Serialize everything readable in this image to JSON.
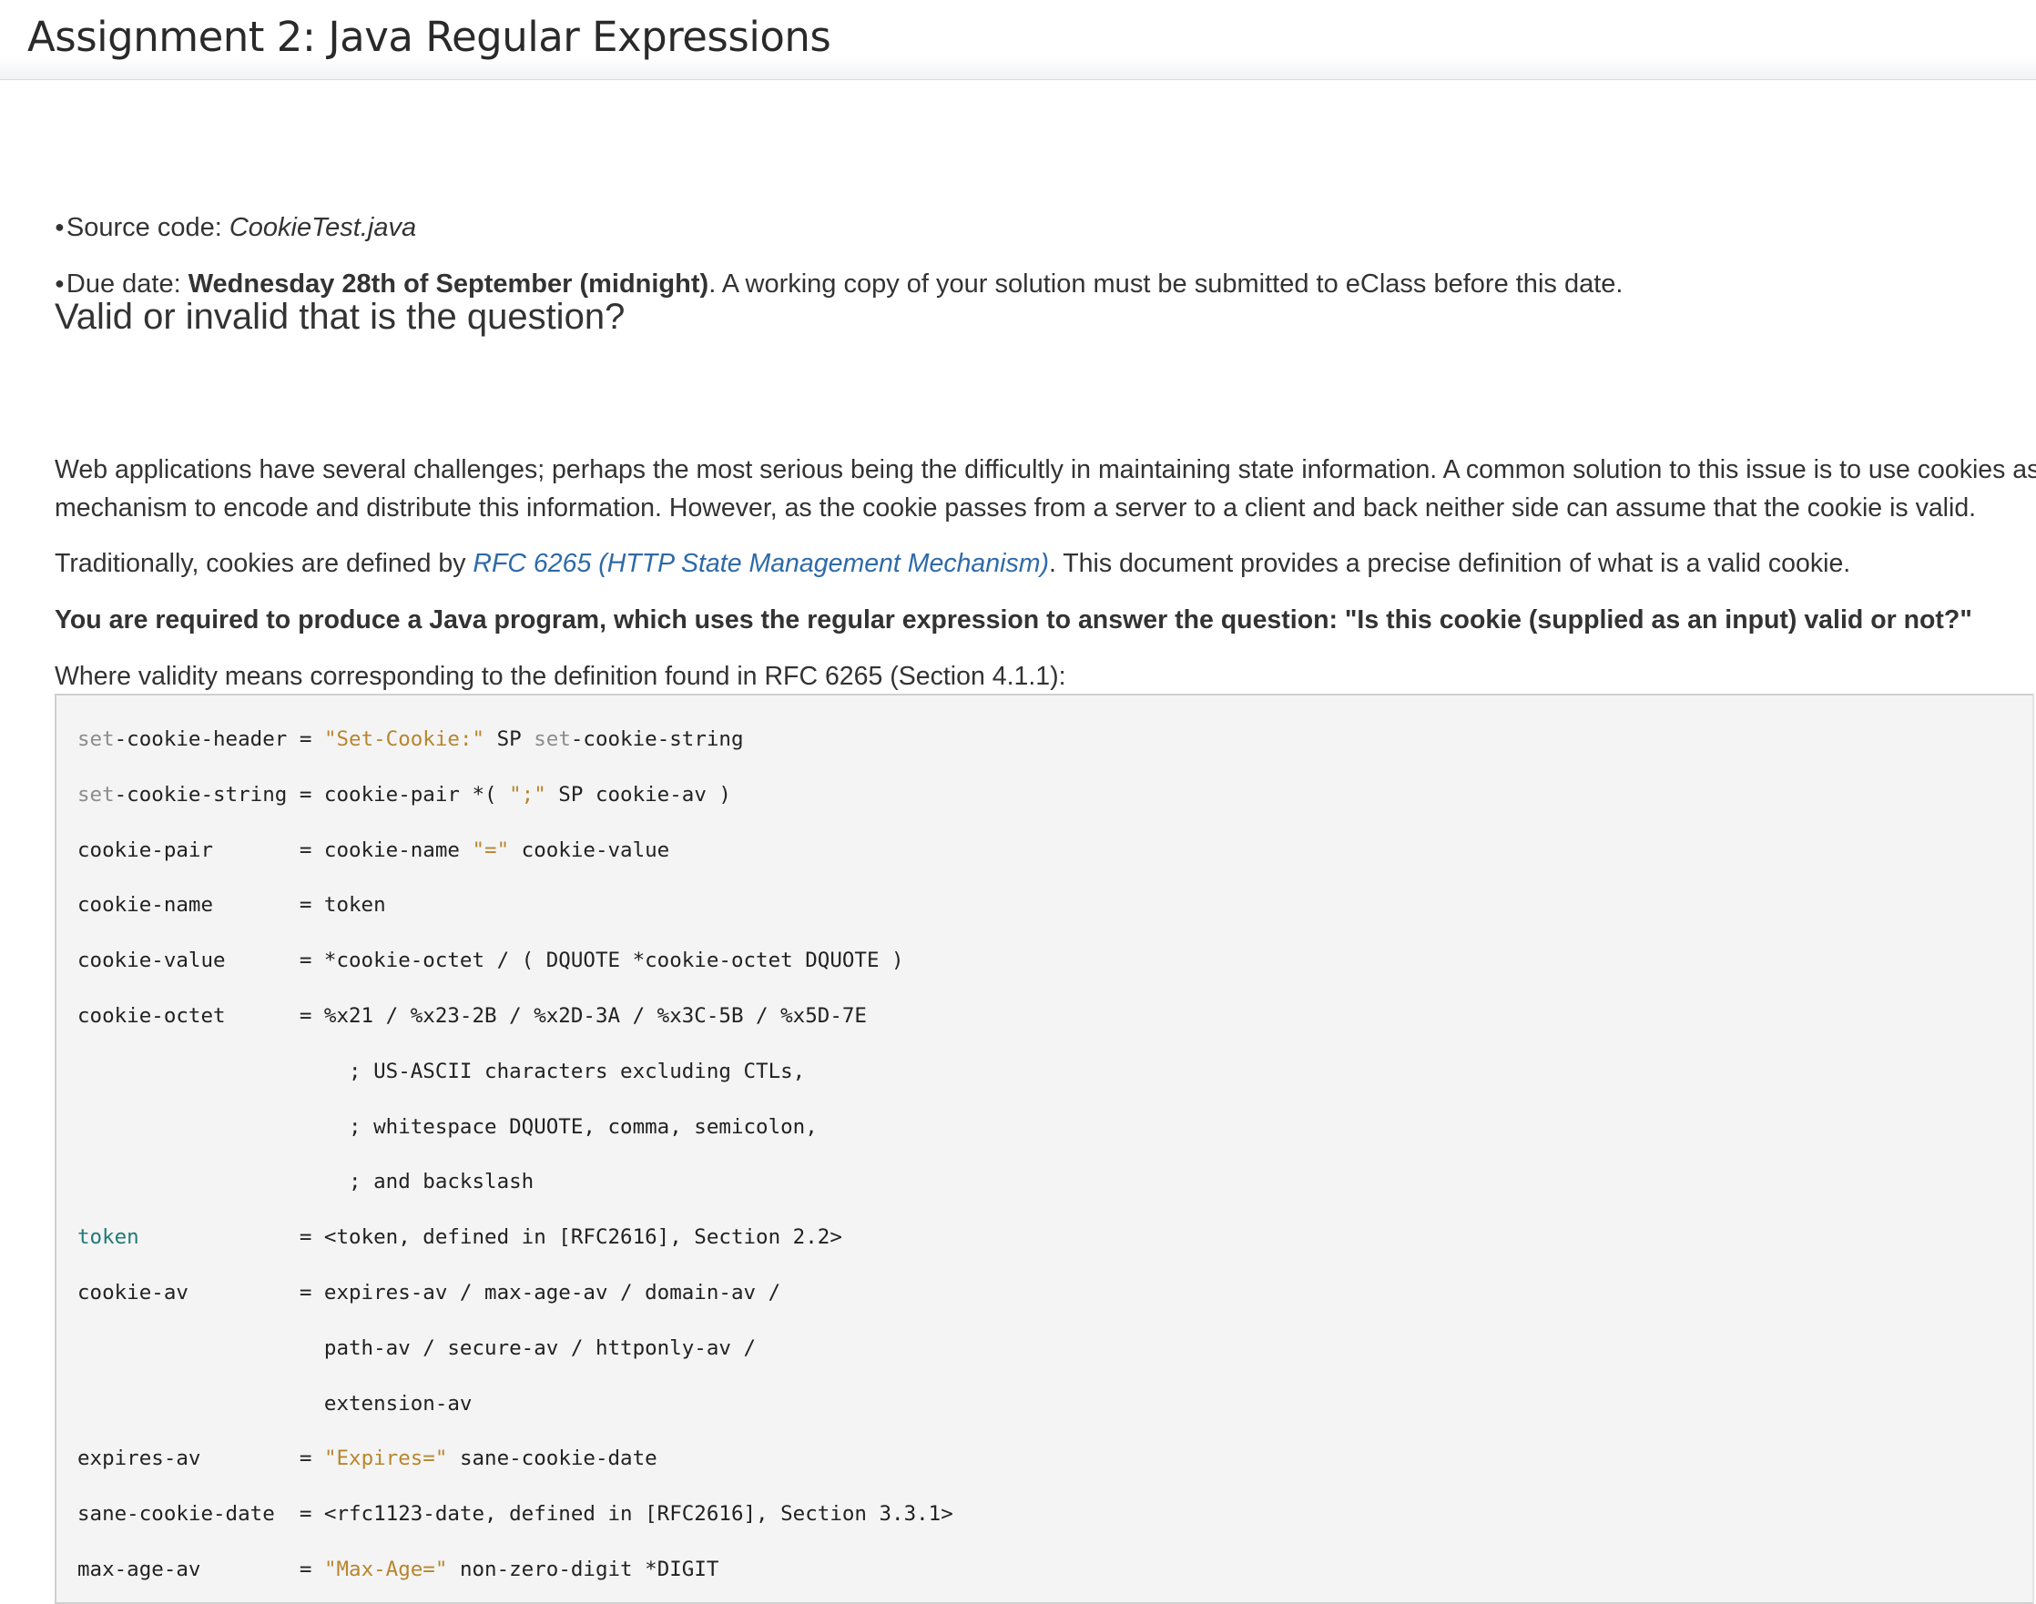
{
  "page": {
    "title": "Assignment 2: Java Regular Expressions"
  },
  "info": {
    "source_label": "Source code: ",
    "source_file": "CookieTest.java",
    "due_label": "Due date: ",
    "due_date": "Wednesday 28th of September (midnight)",
    "due_note": ". A working copy of your solution must be submitted to eClass before this date."
  },
  "section": {
    "heading": "Valid or invalid that is the question?",
    "para1_line1": "Web applications have several challenges; perhaps the most serious being the difficultly in maintaining state information. A common solution to this issue is to use cookies as a",
    "para1_line2": "mechanism to encode and distribute this information. However, as the cookie passes from a server to a client and back neither side can assume that the cookie is valid.",
    "para2_pre": "Traditionally, cookies are defined by ",
    "para2_link": "RFC 6265 (HTTP State Management Mechanism)",
    "para2_post": ". This document provides a precise definition of what is a valid cookie.",
    "requirement": "You are required to produce a Java program, which uses the regular expression to answer the question: \"Is this cookie (supplied as an input) valid or not?\"",
    "validity": "Where validity means corresponding to the definition found in RFC 6265 (Section 4.1.1):"
  },
  "code": {
    "l1": [
      {
        "t": "set",
        "c": "kw"
      },
      {
        "t": "-cookie-header = "
      },
      {
        "t": "\"Set-Cookie:\"",
        "c": "str"
      },
      {
        "t": " SP "
      },
      {
        "t": "set",
        "c": "kw"
      },
      {
        "t": "-cookie-string"
      }
    ],
    "l2": [
      {
        "t": "set",
        "c": "kw"
      },
      {
        "t": "-cookie-string = cookie-pair *( "
      },
      {
        "t": "\";\"",
        "c": "str"
      },
      {
        "t": " SP cookie-av )"
      }
    ],
    "l3": [
      {
        "t": "cookie-pair       = cookie-name "
      },
      {
        "t": "\"=\"",
        "c": "str"
      },
      {
        "t": " cookie-value"
      }
    ],
    "l4": [
      {
        "t": "cookie-name       = token"
      }
    ],
    "l5": [
      {
        "t": "cookie-value      = *cookie-octet / ( DQUOTE *cookie-octet DQUOTE )"
      }
    ],
    "l6": [
      {
        "t": "cookie-octet      = %x21 / %x23-2B / %x2D-3A / %x3C-5B / %x5D-7E"
      }
    ],
    "l7": [
      {
        "t": "                      ; US-ASCII characters excluding CTLs,"
      }
    ],
    "l8": [
      {
        "t": "                      ; whitespace DQUOTE, comma, semicolon,"
      }
    ],
    "l9": [
      {
        "t": "                      ; and backslash"
      }
    ],
    "l10": [
      {
        "t": "token",
        "c": "tok"
      },
      {
        "t": "             = <token, defined in [RFC2616], Section 2.2>"
      }
    ],
    "l11": [
      {
        "t": "cookie-av         = expires-av / max-age-av / domain-av /"
      }
    ],
    "l12": [
      {
        "t": "                    path-av / secure-av / httponly-av /"
      }
    ],
    "l13": [
      {
        "t": "                    extension-av"
      }
    ],
    "l14": [
      {
        "t": "expires-av        = "
      },
      {
        "t": "\"Expires=\"",
        "c": "str"
      },
      {
        "t": " sane-cookie-date"
      }
    ],
    "l15": [
      {
        "t": "sane-cookie-date  = <rfc1123-date, defined in [RFC2616], Section 3.3.1>"
      }
    ],
    "l16": [
      {
        "t": "max-age-av        = "
      },
      {
        "t": "\"Max-Age=\"",
        "c": "str"
      },
      {
        "t": " non-zero-digit *DIGIT"
      }
    ]
  }
}
